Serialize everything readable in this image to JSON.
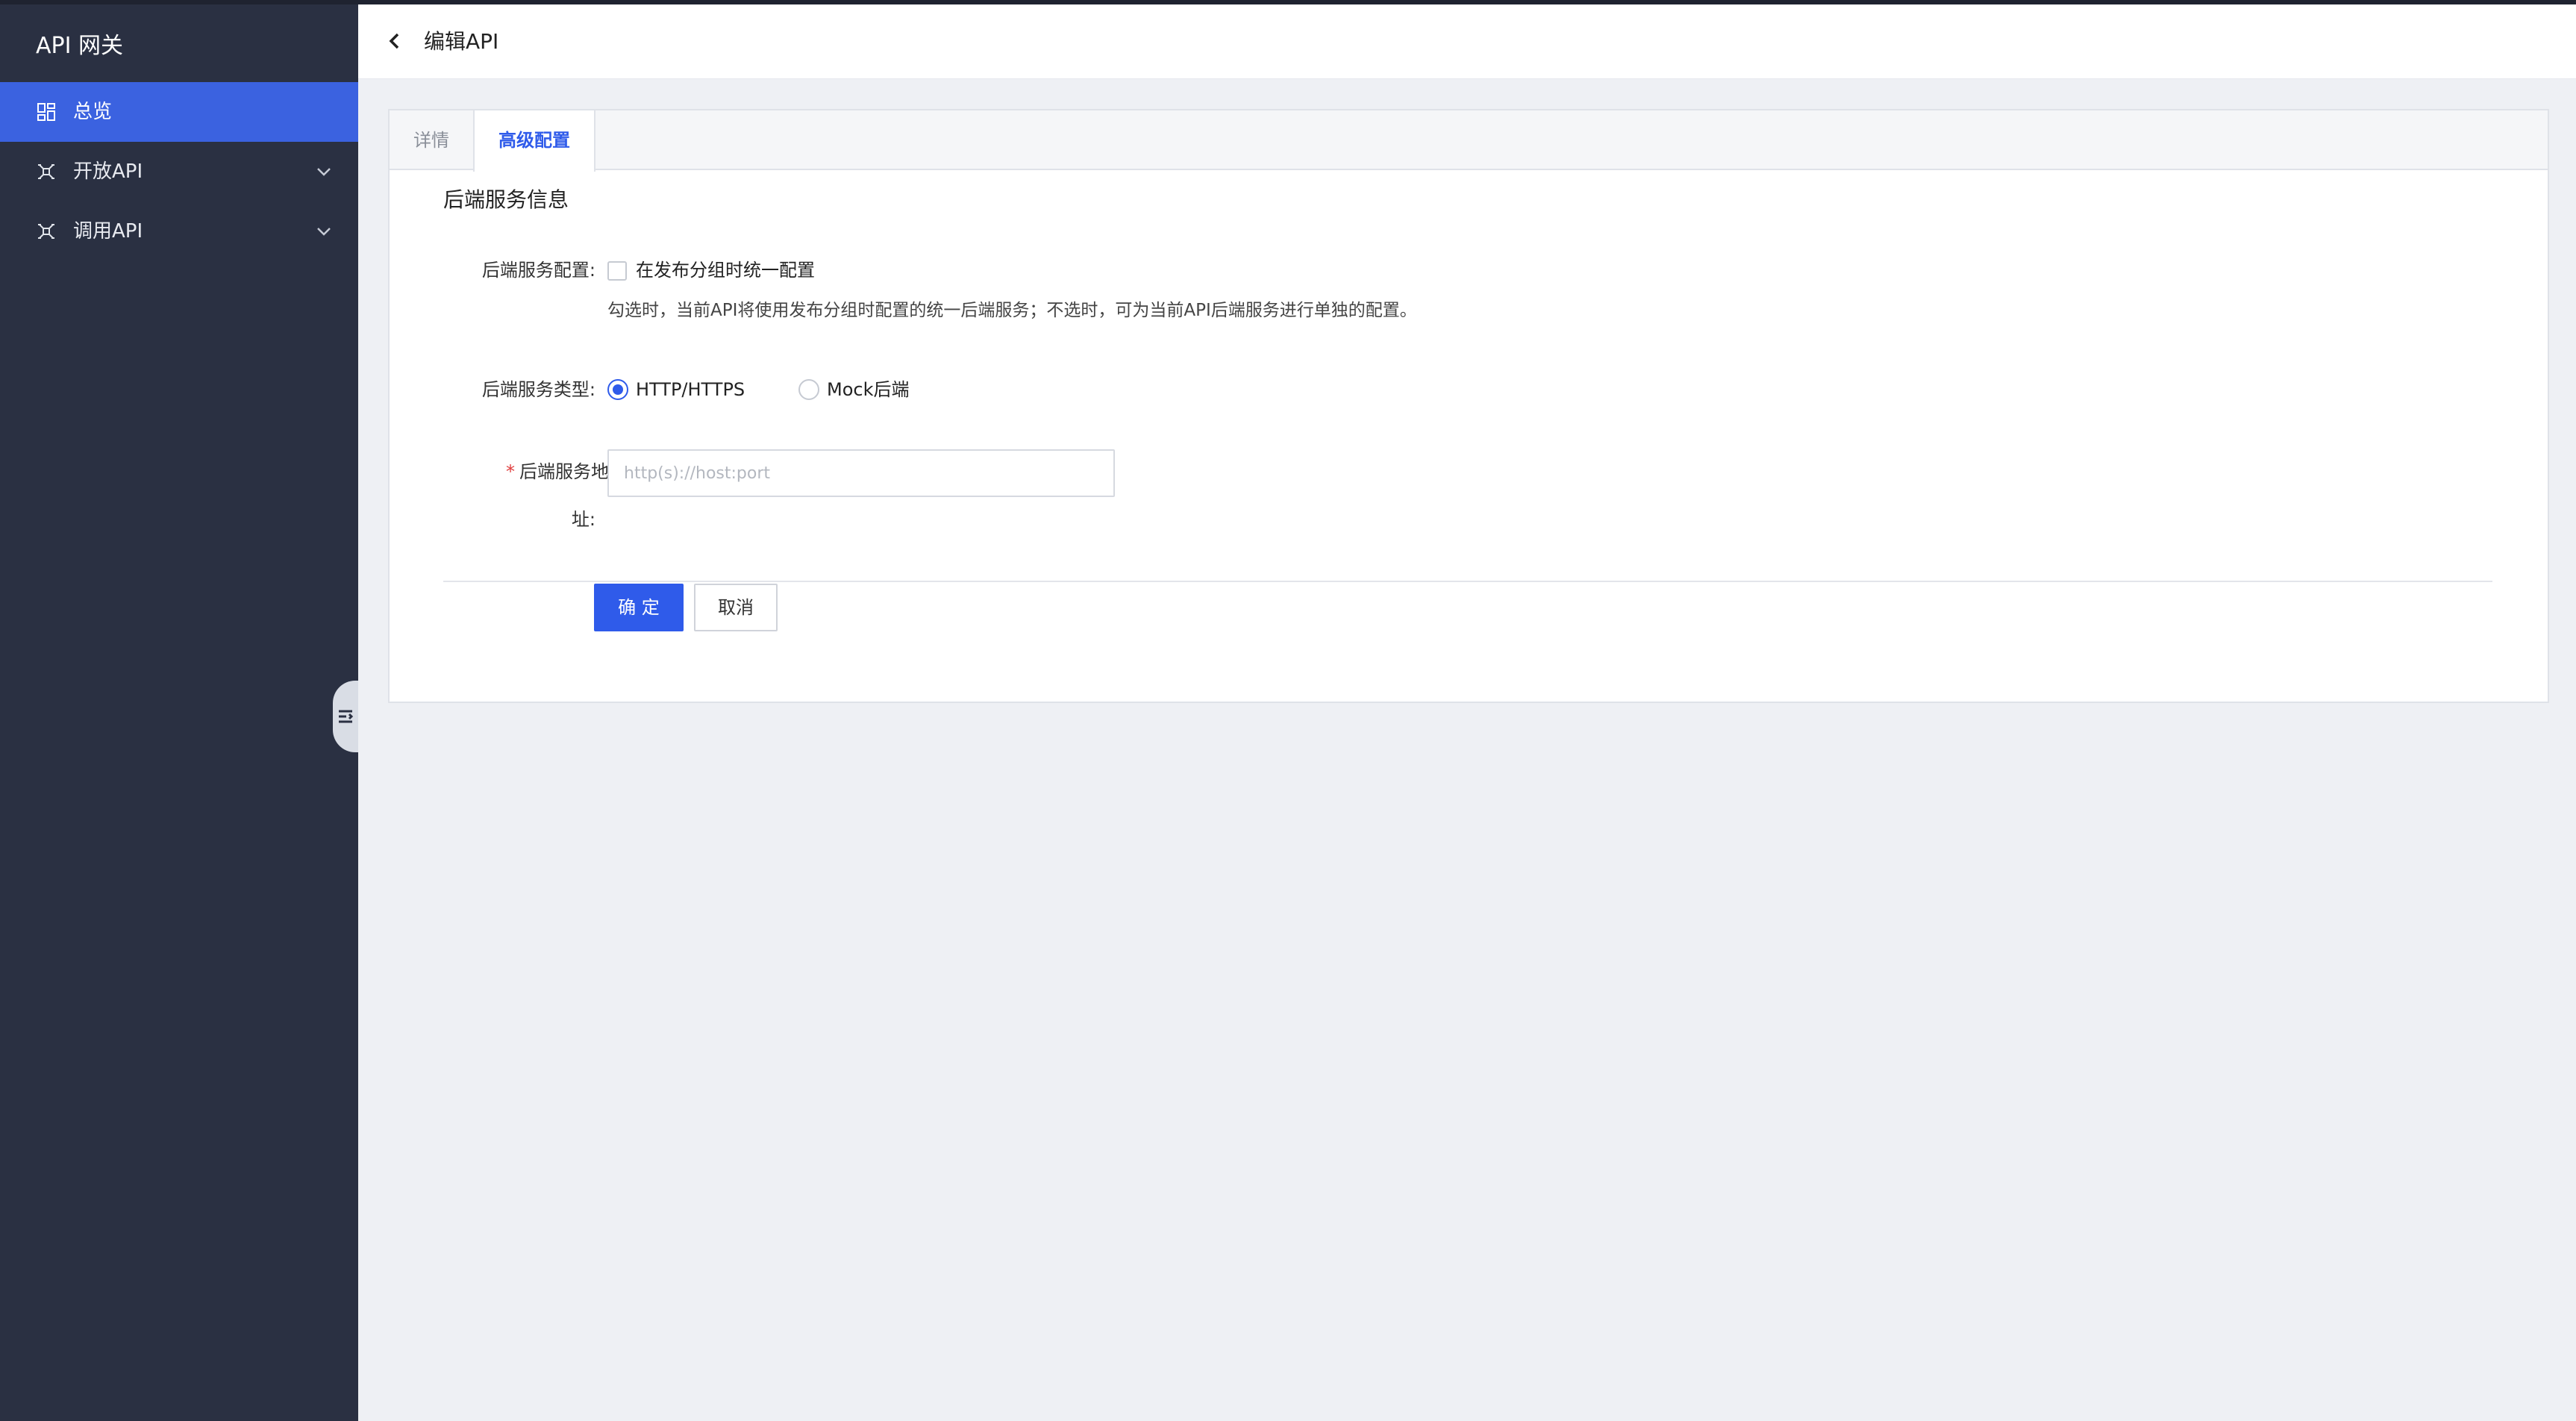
{
  "sidebar": {
    "brand": "API 网关",
    "items": [
      {
        "label": "总览",
        "icon": "dashboard-icon",
        "active": true
      },
      {
        "label": "开放API",
        "icon": "api-icon",
        "expandable": true
      },
      {
        "label": "调用API",
        "icon": "api-icon",
        "expandable": true
      }
    ]
  },
  "header": {
    "title": "编辑API"
  },
  "tabs": [
    {
      "label": "详情"
    },
    {
      "label": "高级配置",
      "active": true
    }
  ],
  "form": {
    "section_title": "后端服务信息",
    "backend_config": {
      "label": "后端服务配置:",
      "checkbox_label": "在发布分组时统一配置",
      "checked": false,
      "hint": "勾选时，当前API将使用发布分组时配置的统一后端服务；不选时，可为当前API后端服务进行单独的配置。"
    },
    "backend_type": {
      "label": "后端服务类型:",
      "options": [
        "HTTP/HTTPS",
        "Mock后端"
      ],
      "selected": "HTTP/HTTPS"
    },
    "backend_address": {
      "required_mark": "*",
      "label_line1": "后端服务地",
      "label_line2": "址:",
      "placeholder": "http(s)://host:port",
      "value": ""
    }
  },
  "actions": {
    "confirm": "确 定",
    "cancel": "取消"
  },
  "colors": {
    "sidebar_bg": "#2a3042",
    "accent": "#2f5bea",
    "required": "#e03e3e"
  }
}
